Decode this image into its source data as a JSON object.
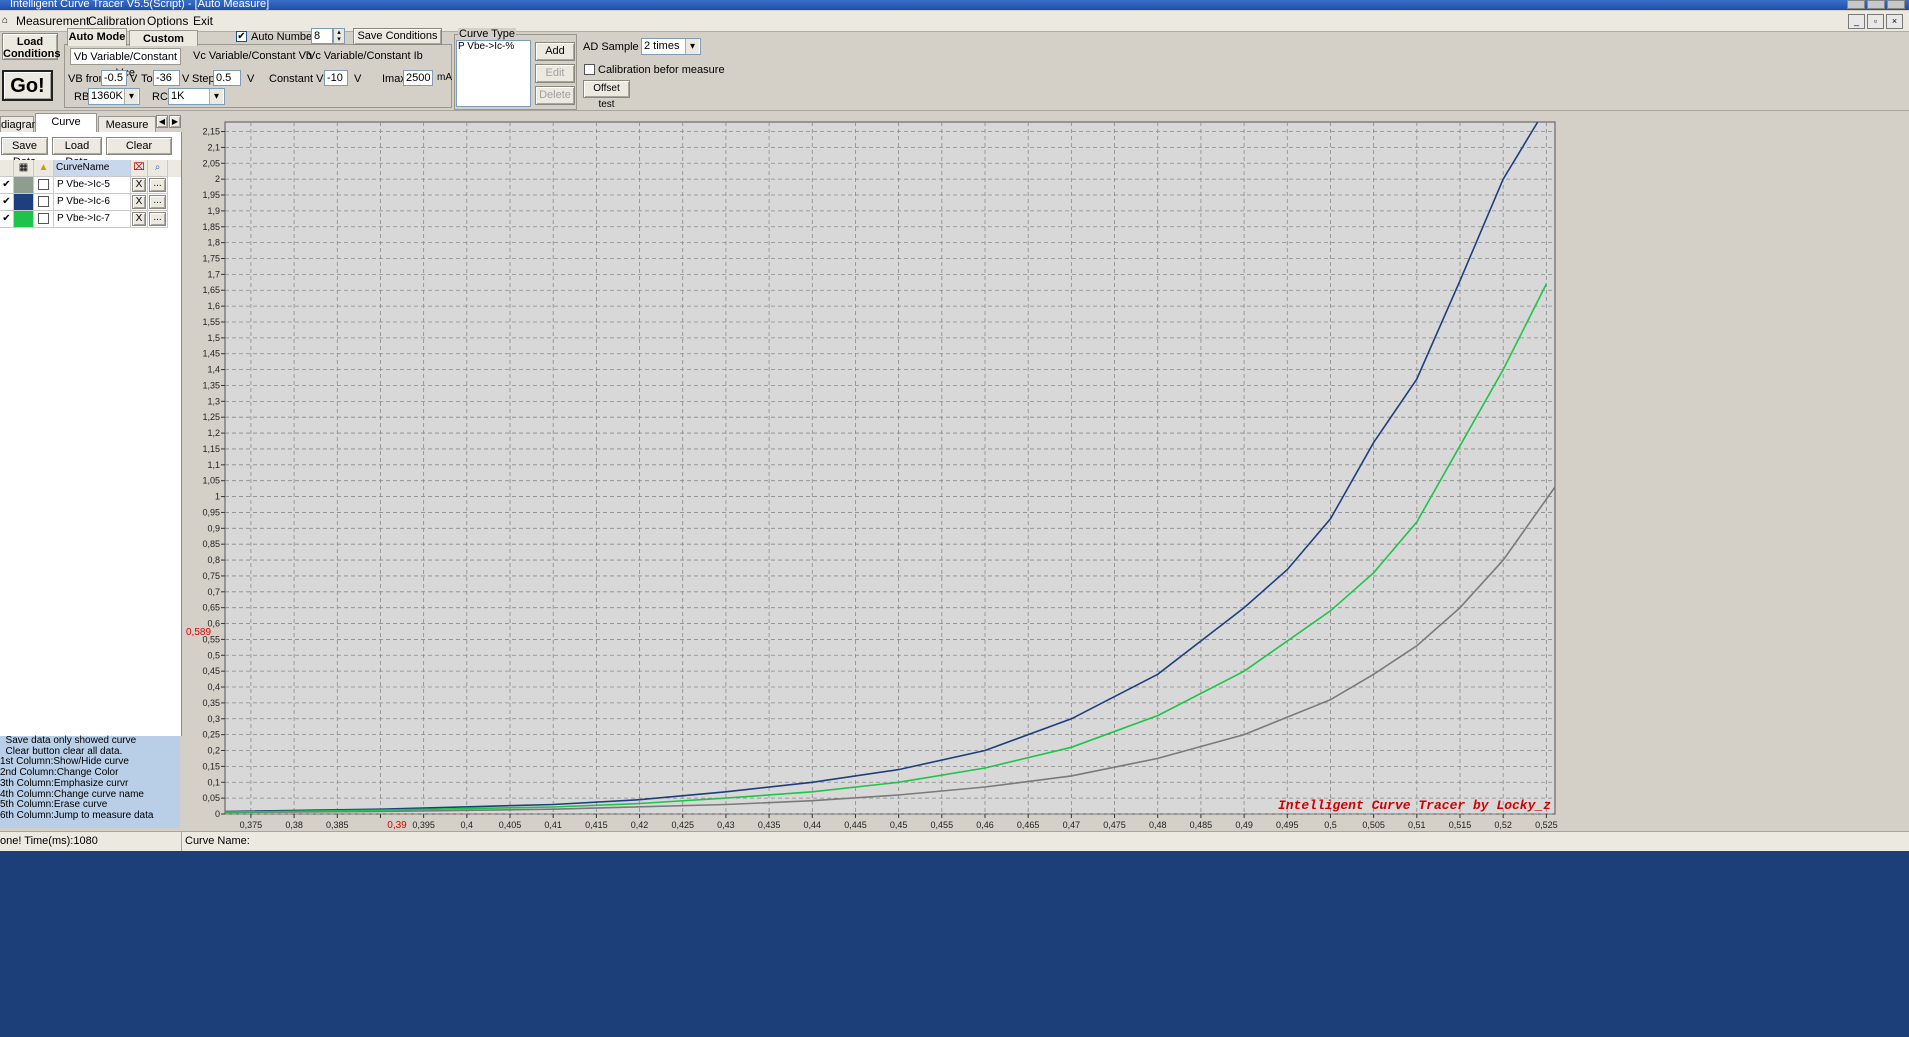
{
  "window": {
    "title": "Intelligent Curve Tracer V5.5(Script) - [Auto Measure]"
  },
  "menu": [
    "Measurement",
    "Calibration",
    "Options",
    "Exit"
  ],
  "toolbar": {
    "load_conditions": [
      "Load",
      "Conditions"
    ],
    "go": "Go!",
    "auto_mode_tab": "Auto Mode",
    "custom_mode_tab": "Custom Mode",
    "auto_number_label": "Auto Number",
    "auto_number_checked": true,
    "auto_number_value": "8",
    "save_conditions": "Save Conditions",
    "subtabs": [
      "Vb Variable/Constant Vce",
      "Vc Variable/Constant Vb",
      "Vc Variable/Constant Ib"
    ],
    "vb_from_label": "VB from",
    "vb_from_value": "-0.5",
    "v_unit": "V",
    "to_label": "To",
    "to_value": "-36",
    "step_label": "Step",
    "step_value": "0.5",
    "constant_vce_label": "Constant Vce",
    "constant_vce_value": "-10",
    "imax_label": "Imax",
    "imax_value": "2500",
    "ma_unit": "mA",
    "rb_label": "RB",
    "rb_value": "1360K",
    "rc_label": "RC",
    "rc_value": "1K"
  },
  "curve_type": {
    "title": "Curve Type",
    "items": [
      "P Vbe->Ic-%"
    ],
    "add": "Add",
    "edit": "Edit",
    "delete": "Delete"
  },
  "ad": {
    "sample_label": "AD Sample",
    "sample_value": "2 times",
    "calibration_label": "Calibration befor measure",
    "calibration_checked": false,
    "offset_test": "Offset test"
  },
  "left": {
    "tabs": [
      "diagram",
      "Curve Control",
      "Measure Data"
    ],
    "save_data": "Save Data",
    "load_data": "Load Data",
    "clear": "Clear",
    "col_header": "CurveName",
    "rows": [
      {
        "shown": true,
        "color": "#8f9d90",
        "name": "P Vbe->Ic-5",
        "x": "X",
        "more": "..."
      },
      {
        "shown": true,
        "color": "#1d3f7d",
        "name": "P Vbe->Ic-6",
        "x": "X",
        "more": "..."
      },
      {
        "shown": true,
        "color": "#1ec44a",
        "name": "P Vbe->Ic-7",
        "x": "X",
        "more": "..."
      }
    ],
    "help": [
      "  Save data only showed curve",
      "  Clear button clear all data.",
      "1st Column:Show/Hide curve",
      "2nd Column:Change Color",
      "3th Column:Emphasize curvr",
      "4th Column:Change curve name",
      "5th Column:Erase curve",
      "6th Column:Jump to measure data"
    ]
  },
  "status": {
    "left": "one!  Time(ms):1080",
    "curve_name_label": "Curve Name:"
  },
  "chart_data": {
    "type": "line",
    "watermark": "Intelligent Curve Tracer by Locky_z",
    "xlim": [
      0.372,
      0.526
    ],
    "ylim": [
      0,
      2.18
    ],
    "x_ticks": [
      "0,375",
      "0,38",
      "0,385",
      "0,39",
      "0,395",
      "0,4",
      "0,405",
      "0,41",
      "0,415",
      "0,42",
      "0,425",
      "0,43",
      "0,435",
      "0,44",
      "0,445",
      "0,45",
      "0,455",
      "0,46",
      "0,465",
      "0,47",
      "0,475",
      "0,48",
      "0,485",
      "0,49",
      "0,495",
      "0,5",
      "0,505",
      "0,51",
      "0,515",
      "0,52",
      "0,525"
    ],
    "y_ticks": [
      "0",
      "0,05",
      "0,1",
      "0,15",
      "0,2",
      "0,25",
      "0,3",
      "0,35",
      "0,4",
      "0,45",
      "0,5",
      "0,55",
      "0,6",
      "0,65",
      "0,7",
      "0,75",
      "0,8",
      "0,85",
      "0,9",
      "0,95",
      "1",
      "1,05",
      "1,1",
      "1,15",
      "1,2",
      "1,25",
      "1,3",
      "1,35",
      "1,4",
      "1,45",
      "1,5",
      "1,55",
      "1,6",
      "1,65",
      "1,7",
      "1,75",
      "1,8",
      "1,85",
      "1,9",
      "1,95",
      "2",
      "2,05",
      "2,1",
      "2,15"
    ],
    "cursor_x_label": "0,39",
    "cursor_y_label": "0,589",
    "grid": true,
    "series": [
      {
        "name": "P Vbe->Ic-5",
        "color": "#7a7a7a",
        "x": [
          0.372,
          0.39,
          0.41,
          0.43,
          0.44,
          0.45,
          0.46,
          0.47,
          0.48,
          0.49,
          0.5,
          0.505,
          0.51,
          0.515,
          0.52,
          0.526
        ],
        "y": [
          0.005,
          0.008,
          0.015,
          0.03,
          0.042,
          0.06,
          0.085,
          0.12,
          0.175,
          0.25,
          0.36,
          0.44,
          0.53,
          0.65,
          0.8,
          1.03
        ]
      },
      {
        "name": "P Vbe->Ic-6",
        "color": "#1d3f7d",
        "x": [
          0.372,
          0.39,
          0.41,
          0.42,
          0.43,
          0.44,
          0.45,
          0.46,
          0.47,
          0.48,
          0.49,
          0.495,
          0.5,
          0.505,
          0.51,
          0.515,
          0.52,
          0.524
        ],
        "y": [
          0.008,
          0.015,
          0.03,
          0.045,
          0.07,
          0.1,
          0.14,
          0.2,
          0.3,
          0.44,
          0.65,
          0.77,
          0.93,
          1.17,
          1.37,
          1.68,
          2.0,
          2.18
        ]
      },
      {
        "name": "P Vbe->Ic-7",
        "color": "#1ec44a",
        "x": [
          0.372,
          0.39,
          0.41,
          0.42,
          0.43,
          0.44,
          0.45,
          0.46,
          0.47,
          0.48,
          0.49,
          0.5,
          0.505,
          0.51,
          0.515,
          0.52,
          0.525
        ],
        "y": [
          0.006,
          0.012,
          0.022,
          0.033,
          0.05,
          0.07,
          0.1,
          0.145,
          0.21,
          0.31,
          0.45,
          0.64,
          0.76,
          0.92,
          1.16,
          1.4,
          1.67
        ]
      }
    ]
  }
}
